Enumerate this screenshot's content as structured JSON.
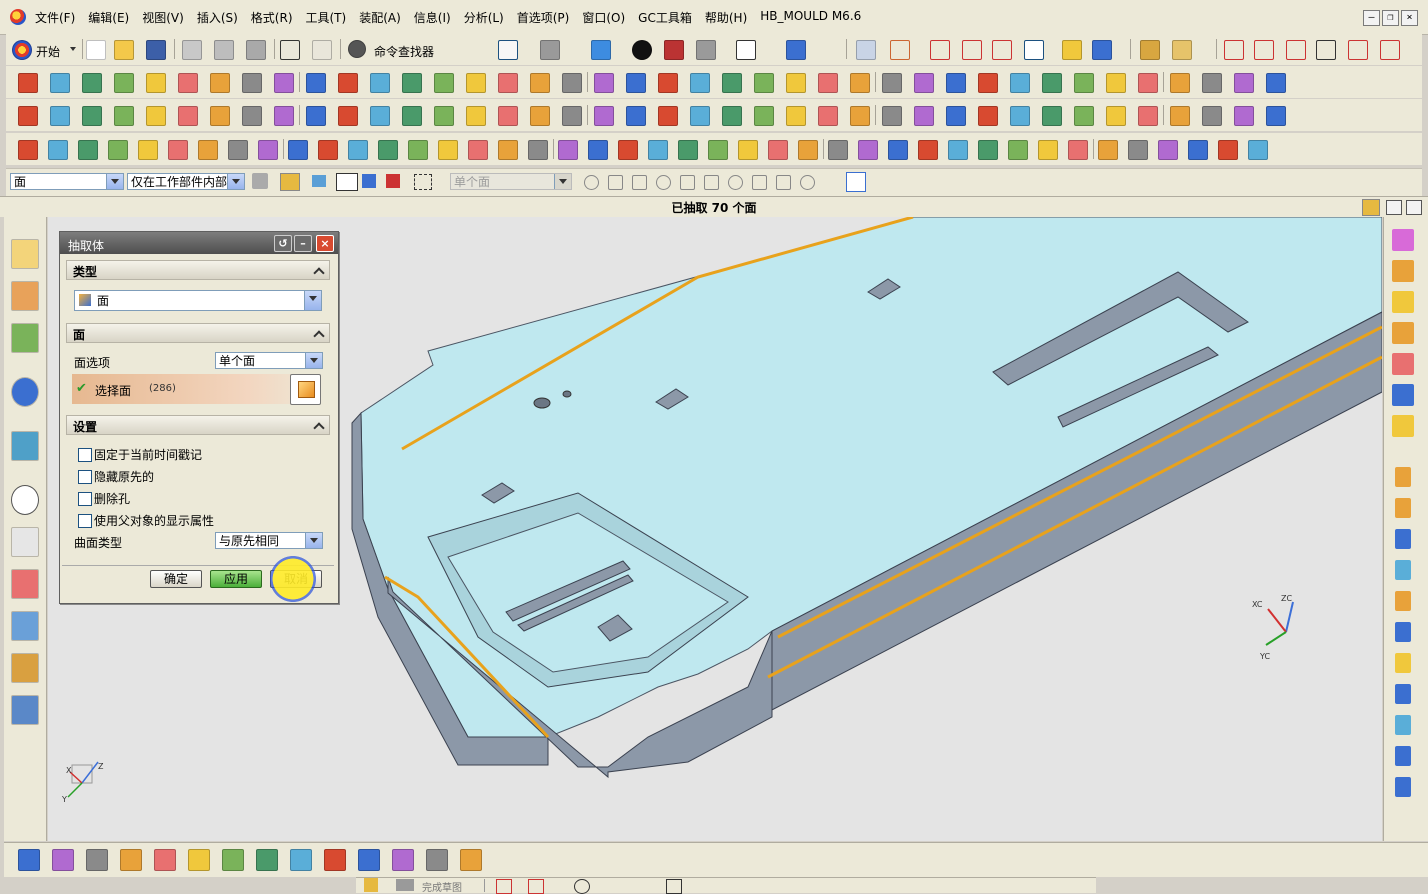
{
  "menubar": {
    "items": [
      "文件(F)",
      "编辑(E)",
      "视图(V)",
      "插入(S)",
      "格式(R)",
      "工具(T)",
      "装配(A)",
      "信息(I)",
      "分析(L)",
      "首选项(P)",
      "窗口(O)",
      "GC工具箱",
      "帮助(H)",
      "HB_MOULD M6.6"
    ],
    "window_buttons": [
      "–",
      "❐",
      "×"
    ]
  },
  "toolbar": {
    "start_label": "开始",
    "command_finder_label": "命令查找器"
  },
  "selection_bar": {
    "filter_type": "面",
    "scope": "仅在工作部件内部",
    "face_rule": "单个面"
  },
  "status": {
    "message": "已抽取 70 个面"
  },
  "dialog": {
    "title": "抽取体",
    "groups": {
      "type": {
        "header": "类型",
        "value": "面"
      },
      "face": {
        "header": "面",
        "option_label": "面选项",
        "option_value": "单个面",
        "select_label": "选择面",
        "select_count": "(286)"
      },
      "settings": {
        "header": "设置",
        "checkboxes": [
          "固定于当前时间戳记",
          "隐藏原先的",
          "删除孔",
          "使用父对象的显示属性"
        ],
        "surface_type_label": "曲面类型",
        "surface_type_value": "与原先相同"
      }
    },
    "buttons": {
      "ok": "确定",
      "apply": "应用",
      "cancel": "取消"
    }
  },
  "viewport": {
    "csys_labels": [
      "XC",
      "ZC",
      "YC"
    ],
    "triad_labels": [
      "Z",
      "X",
      "Y"
    ]
  },
  "bottom_toolbar": {
    "finish_sketch_label": "完成草图"
  },
  "colors": {
    "model_face": "#bfe8ef",
    "model_side": "#8c98a8",
    "edge_highlight": "#e8a21c",
    "viewport_bg": "#e4e4e4"
  }
}
